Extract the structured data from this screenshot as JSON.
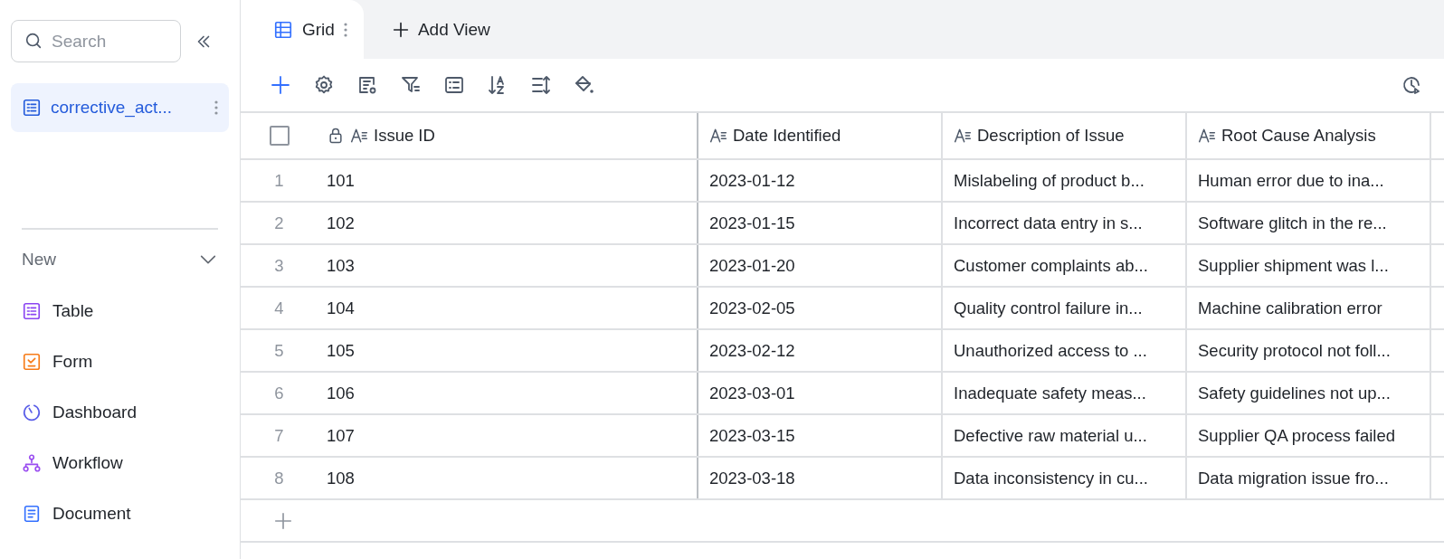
{
  "sidebar": {
    "search": {
      "placeholder": "Search"
    },
    "tables": [
      {
        "label": "corrective_act...",
        "selected": true
      }
    ],
    "new_section": {
      "label": "New",
      "expanded": true,
      "items": [
        {
          "kind": "table",
          "label": "Table"
        },
        {
          "kind": "form",
          "label": "Form"
        },
        {
          "kind": "dashboard",
          "label": "Dashboard"
        },
        {
          "kind": "workflow",
          "label": "Workflow"
        },
        {
          "kind": "document",
          "label": "Document"
        }
      ]
    }
  },
  "tabs": [
    {
      "label": "Grid",
      "selected": true
    }
  ],
  "add_view": "Add View",
  "table": {
    "select_all_checked": false,
    "columns": [
      {
        "label": "Issue ID",
        "locked": true
      },
      {
        "label": "Date Identified",
        "locked": false
      },
      {
        "label": "Description of Issue",
        "locked": false
      },
      {
        "label": "Root Cause Analysis",
        "locked": false
      }
    ],
    "rows": [
      {
        "number": "1",
        "cells": [
          "101",
          "2023-01-12",
          "Mislabeling of product b...",
          "Human error due to ina..."
        ]
      },
      {
        "number": "2",
        "cells": [
          "102",
          "2023-01-15",
          "Incorrect data entry in s...",
          "Software glitch in the re..."
        ]
      },
      {
        "number": "3",
        "cells": [
          "103",
          "2023-01-20",
          "Customer complaints ab...",
          "Supplier shipment was l..."
        ]
      },
      {
        "number": "4",
        "cells": [
          "104",
          "2023-02-05",
          "Quality control failure in...",
          "Machine calibration error"
        ]
      },
      {
        "number": "5",
        "cells": [
          "105",
          "2023-02-12",
          "Unauthorized access to ...",
          "Security protocol not foll..."
        ]
      },
      {
        "number": "6",
        "cells": [
          "106",
          "2023-03-01",
          "Inadequate safety meas...",
          "Safety guidelines not up..."
        ]
      },
      {
        "number": "7",
        "cells": [
          "107",
          "2023-03-15",
          "Defective raw material u...",
          "Supplier QA process failed"
        ]
      },
      {
        "number": "8",
        "cells": [
          "108",
          "2023-03-18",
          "Data inconsistency in cu...",
          "Data migration issue fro..."
        ]
      }
    ]
  }
}
